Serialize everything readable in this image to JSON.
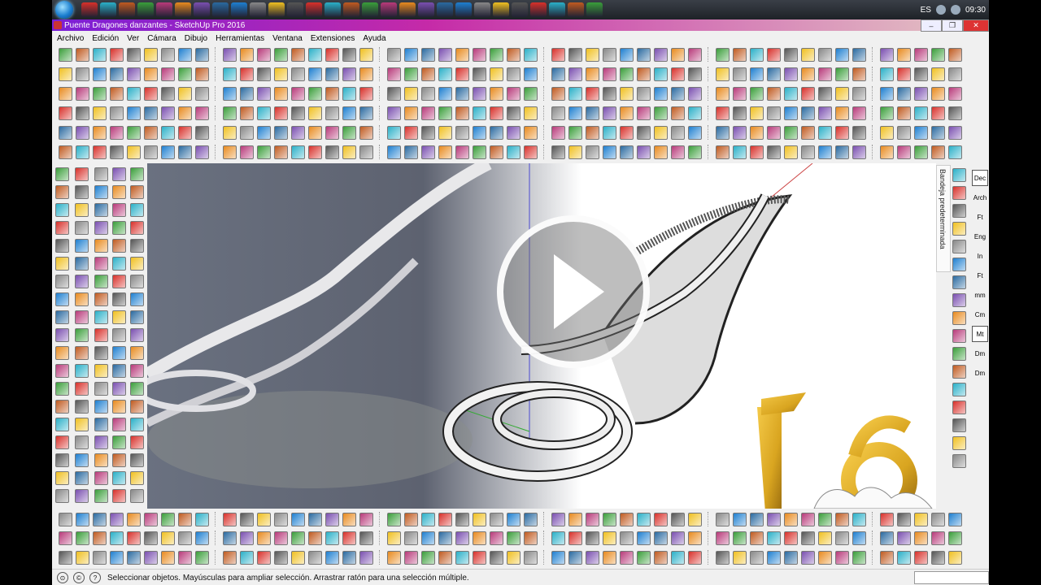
{
  "taskbar": {
    "language": "ES",
    "clock": "09:30"
  },
  "window": {
    "title": "Puente Dragones danzantes - SketchUp Pro 2016"
  },
  "menu": [
    "Archivo",
    "Edición",
    "Ver",
    "Cámara",
    "Dibujo",
    "Herramientas",
    "Ventana",
    "Extensiones",
    "Ayuda"
  ],
  "tray": {
    "label": "Bandeja predeterminada",
    "units": [
      "Dec",
      "Arch",
      "Ft",
      "Eng",
      "In",
      "Ft",
      "mm",
      "Cm",
      "Mt",
      "Dm",
      "Dm"
    ]
  },
  "overlay": {
    "version_badge": "16"
  },
  "status": {
    "text": "Seleccionar objetos. Mayúsculas para ampliar selección. Arrastrar ratón para una selección múltiple."
  },
  "colors": {
    "title_gradient_start": "#7a1fd6",
    "title_gradient_end": "#e4c8c4",
    "badge_gold": "#d9a520",
    "accent_red": "#d8302a"
  }
}
